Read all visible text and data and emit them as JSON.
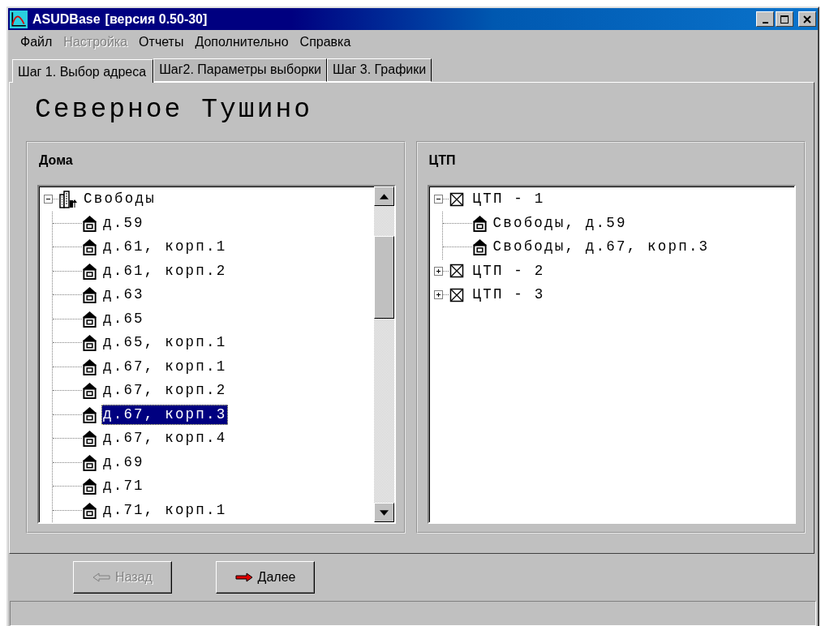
{
  "window": {
    "app_name": "ASUDBase",
    "version": "[версия 0.50-30]"
  },
  "menu": [
    {
      "label": "Файл",
      "disabled": false
    },
    {
      "label": "Настройка",
      "disabled": true
    },
    {
      "label": "Отчеты",
      "disabled": false
    },
    {
      "label": "Дополнительно",
      "disabled": false
    },
    {
      "label": "Справка",
      "disabled": false
    }
  ],
  "tabs": [
    {
      "label": "Шаг 1. Выбор адреса",
      "selected": true
    },
    {
      "label": "Шаг2. Параметры выборки",
      "selected": false
    },
    {
      "label": "Шаг 3. Графики",
      "selected": false
    }
  ],
  "heading": "Северное Тушино",
  "panels": [
    {
      "title": "Дома",
      "scrollbar": true,
      "tree": [
        {
          "kind": "street",
          "label": "Свободы",
          "expanded": true,
          "selected": false,
          "children": [
            {
              "kind": "house",
              "label": "д.59",
              "selected": false
            },
            {
              "kind": "house",
              "label": "д.61, корп.1",
              "selected": false
            },
            {
              "kind": "house",
              "label": "д.61, корп.2",
              "selected": false
            },
            {
              "kind": "house",
              "label": "д.63",
              "selected": false
            },
            {
              "kind": "house",
              "label": "д.65",
              "selected": false
            },
            {
              "kind": "house",
              "label": "д.65, корп.1",
              "selected": false
            },
            {
              "kind": "house",
              "label": "д.67, корп.1",
              "selected": false
            },
            {
              "kind": "house",
              "label": "д.67, корп.2",
              "selected": false
            },
            {
              "kind": "house",
              "label": "д.67, корп.3",
              "selected": true
            },
            {
              "kind": "house",
              "label": "д.67, корп.4",
              "selected": false
            },
            {
              "kind": "house",
              "label": "д.69",
              "selected": false
            },
            {
              "kind": "house",
              "label": "д.71",
              "selected": false
            },
            {
              "kind": "house",
              "label": "д.71, корп.1",
              "selected": false
            }
          ]
        }
      ]
    },
    {
      "title": "ЦТП",
      "scrollbar": false,
      "tree": [
        {
          "kind": "station",
          "label": "ЦТП - 1",
          "expanded": true,
          "selected": false,
          "children": [
            {
              "kind": "house",
              "label": "Свободы, д.59",
              "selected": false
            },
            {
              "kind": "house",
              "label": "Свободы, д.67, корп.3",
              "selected": false
            }
          ]
        },
        {
          "kind": "station",
          "label": "ЦТП - 2",
          "expanded": false,
          "selected": false
        },
        {
          "kind": "station",
          "label": "ЦТП - 3",
          "expanded": false,
          "selected": false
        }
      ]
    }
  ],
  "buttons": [
    {
      "kind": "back",
      "label": "Назад",
      "disabled": true
    },
    {
      "kind": "next",
      "label": "Далее",
      "disabled": false
    }
  ]
}
